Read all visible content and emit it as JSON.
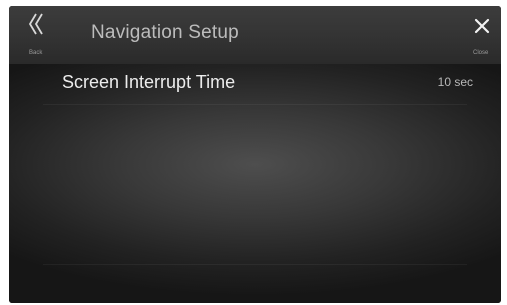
{
  "header": {
    "back_label": "Back",
    "title": "Navigation Setup",
    "close_label": "Close"
  },
  "settings": [
    {
      "label": "Screen Interrupt Time",
      "value": "10 sec"
    }
  ],
  "icons": {
    "back": "double-chevron-left-icon",
    "close": "close-icon"
  },
  "colors": {
    "header_bg": "#343434",
    "text_primary": "#ececec",
    "text_secondary": "#b8b8b8"
  }
}
